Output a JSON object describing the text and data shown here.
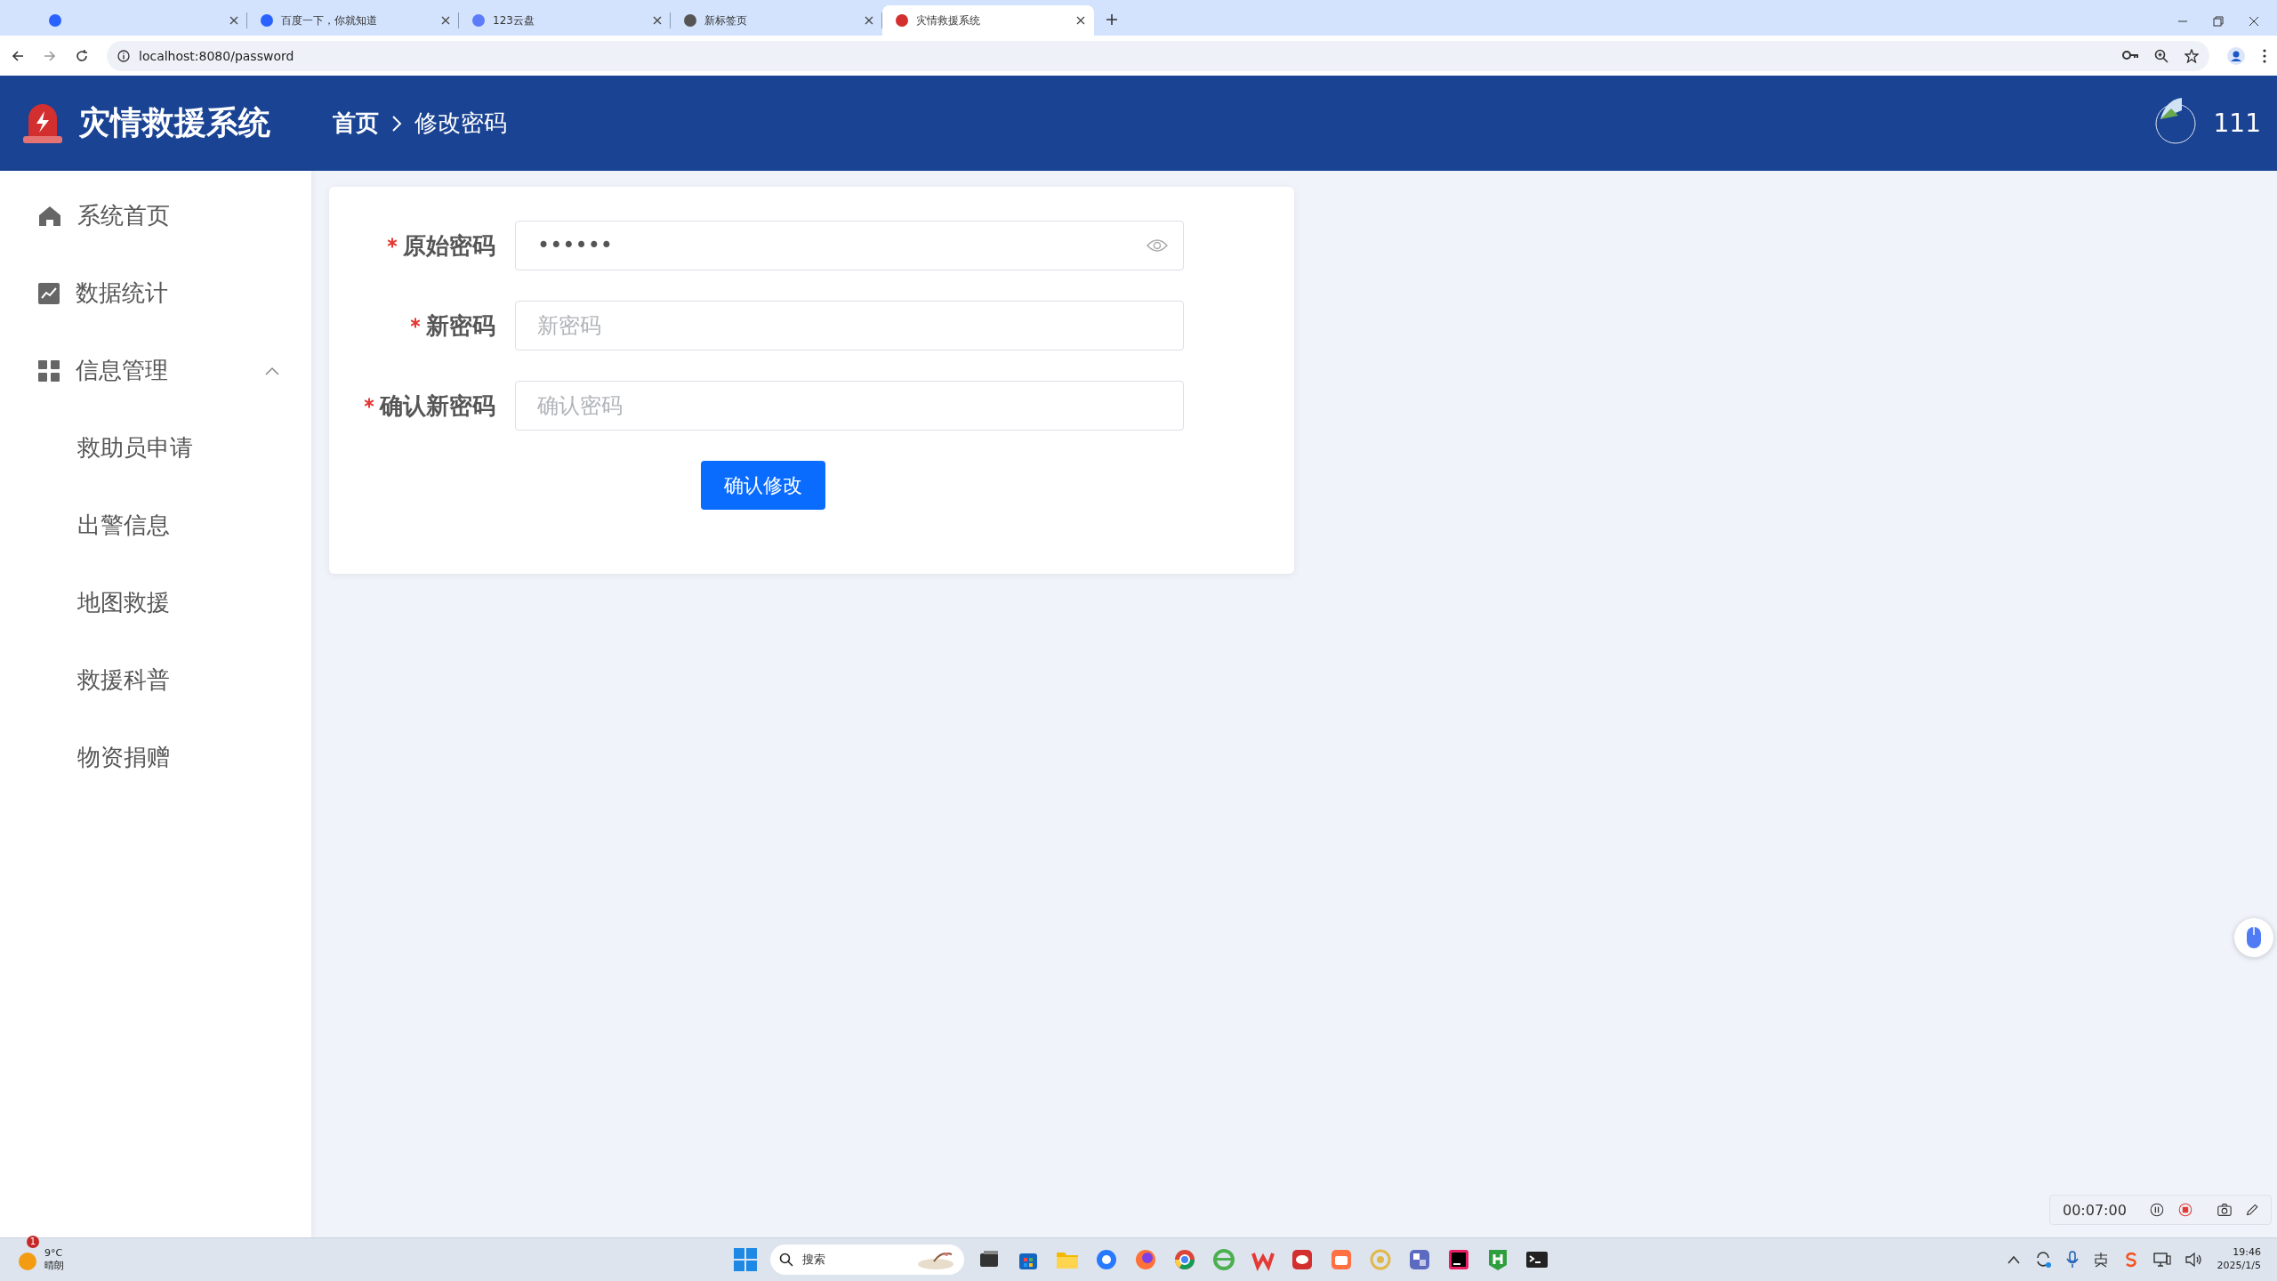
{
  "browser": {
    "tabs": [
      {
        "selected": false
      },
      {
        "title": "百度一下，你就知道",
        "selected": false
      },
      {
        "title": "123云盘",
        "selected": false
      },
      {
        "title": "新标签页",
        "selected": false
      },
      {
        "title": "灾情救援系统",
        "selected": true
      }
    ],
    "url": "localhost:8080/password"
  },
  "header": {
    "title": "灾情救援系统",
    "breadcrumb": [
      "首页",
      "修改密码"
    ],
    "user": "111"
  },
  "sidebar": {
    "items": [
      {
        "label": "系统首页"
      },
      {
        "label": "数据统计"
      },
      {
        "label": "信息管理",
        "expanded": true,
        "children": [
          {
            "label": "救助员申请"
          },
          {
            "label": "出警信息"
          },
          {
            "label": "地图救援"
          },
          {
            "label": "救援科普"
          },
          {
            "label": "物资捐赠"
          }
        ]
      }
    ]
  },
  "form": {
    "fields": [
      {
        "label": "原始密码",
        "required": true,
        "kind": "password",
        "value": "••••••"
      },
      {
        "label": "新密码",
        "required": true,
        "kind": "text",
        "placeholder": "新密码"
      },
      {
        "label": "确认新密码",
        "required": true,
        "kind": "text",
        "placeholder": "确认密码"
      }
    ],
    "submit": "确认修改"
  },
  "recorder": {
    "time": "00:07:00"
  },
  "taskbar": {
    "weather": {
      "badge": "1",
      "temp": "9°C",
      "desc": "晴朗"
    },
    "search": "搜索",
    "time": "19:46",
    "date": "2025/1/5"
  }
}
